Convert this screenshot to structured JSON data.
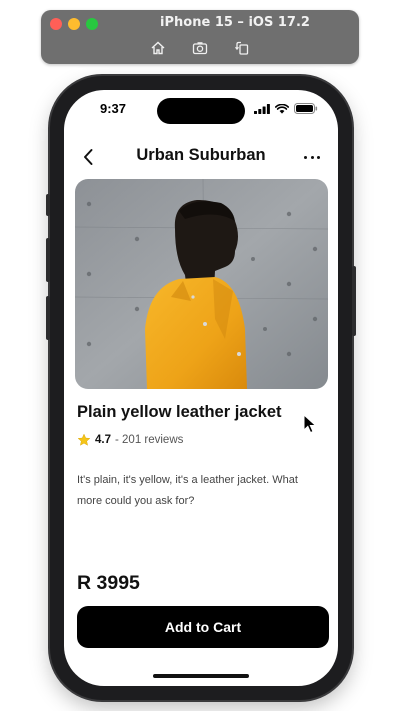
{
  "simulator": {
    "title": "iPhone 15 – iOS 17.2",
    "tools": [
      "home-icon",
      "screenshot-icon",
      "rotate-icon"
    ]
  },
  "status_bar": {
    "time": "9:37",
    "icons": [
      "signal-icon",
      "wifi-icon",
      "battery-icon"
    ]
  },
  "nav": {
    "title": "Urban Suburban",
    "back_icon": "chevron-left-icon",
    "more_icon": "ellipsis-icon"
  },
  "product": {
    "image_alt": "person in yellow leather jacket",
    "name": "Plain yellow leather jacket",
    "rating_icon": "star-icon",
    "rating": "4.7",
    "reviews": "- 201 reviews",
    "description": "It's plain, it's yellow, it's a leather jacket. What more could you ask for?",
    "price": "R 3995"
  },
  "actions": {
    "add_to_cart": "Add to Cart"
  },
  "colors": {
    "accent": "#000000",
    "jacket": "#f2a81d",
    "background": "#ffffff",
    "star": "#f5c518"
  }
}
